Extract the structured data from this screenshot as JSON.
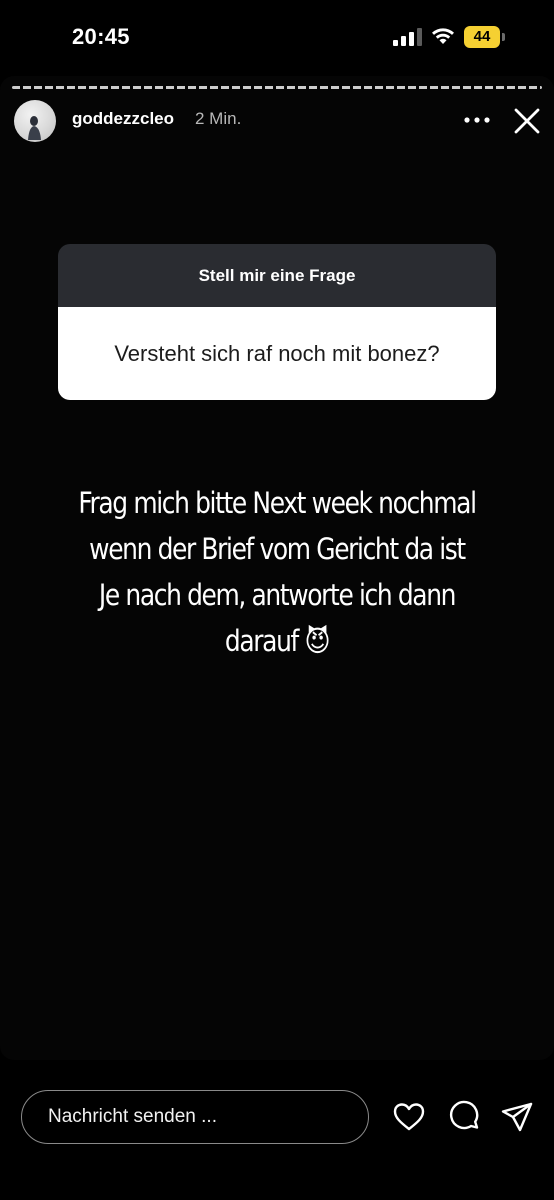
{
  "status_bar": {
    "time": "20:45",
    "battery_level": "44",
    "icons": [
      "signal-icon",
      "wifi-icon",
      "battery-icon"
    ]
  },
  "story": {
    "username": "goddezzcleo",
    "timestamp": "2 Min.",
    "question_sticker": {
      "title": "Stell mir eine Frage",
      "question": "Versteht sich raf noch mit bonez?"
    },
    "reply_text": "Frag mich bitte Next week nochmal\nwenn der Brief vom Gericht da ist\nJe nach dem, antworte ich dann\ndarauf 😈",
    "header_icons": [
      "more-icon",
      "close-icon"
    ]
  },
  "bottom_bar": {
    "message_placeholder": "Nachricht senden ...",
    "icons": [
      "heart-icon",
      "comment-icon",
      "share-icon"
    ]
  },
  "colors": {
    "background": "#000000",
    "sticker_header": "#2a2c31",
    "sticker_body": "#ffffff",
    "battery": "#f5d032"
  }
}
